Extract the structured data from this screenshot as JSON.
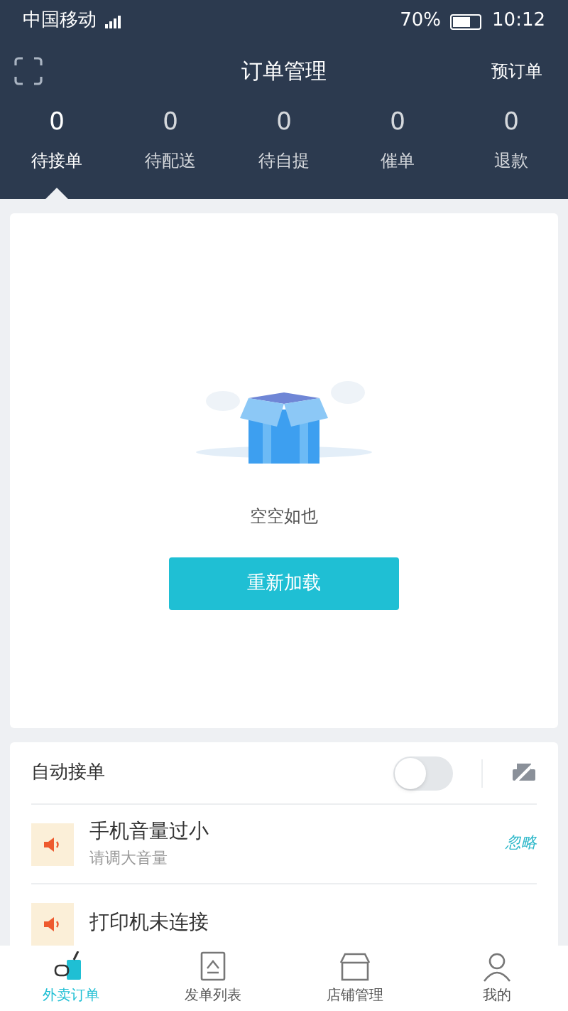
{
  "status_bar": {
    "carrier": "中国移动",
    "battery": "70%",
    "time": "10:12"
  },
  "header": {
    "title": "订单管理",
    "action": "预订单"
  },
  "counters": [
    {
      "count": "0",
      "label": "待接单",
      "selected": true
    },
    {
      "count": "0",
      "label": "待配送",
      "selected": false
    },
    {
      "count": "0",
      "label": "待自提",
      "selected": false
    },
    {
      "count": "0",
      "label": "催单",
      "selected": false
    },
    {
      "count": "0",
      "label": "退款",
      "selected": false
    }
  ],
  "empty_state": {
    "message": "空空如也",
    "button": "重新加载"
  },
  "auto_accept": {
    "label": "自动接单",
    "on": false
  },
  "alerts": [
    {
      "title": "手机音量过小",
      "subtitle": "请调大音量",
      "action": "忽略"
    },
    {
      "title": "打印机未连接"
    }
  ],
  "bottom_nav": [
    {
      "label": "外卖订单",
      "selected": true
    },
    {
      "label": "发单列表",
      "selected": false
    },
    {
      "label": "店铺管理",
      "selected": false
    },
    {
      "label": "我的",
      "selected": false
    }
  ]
}
